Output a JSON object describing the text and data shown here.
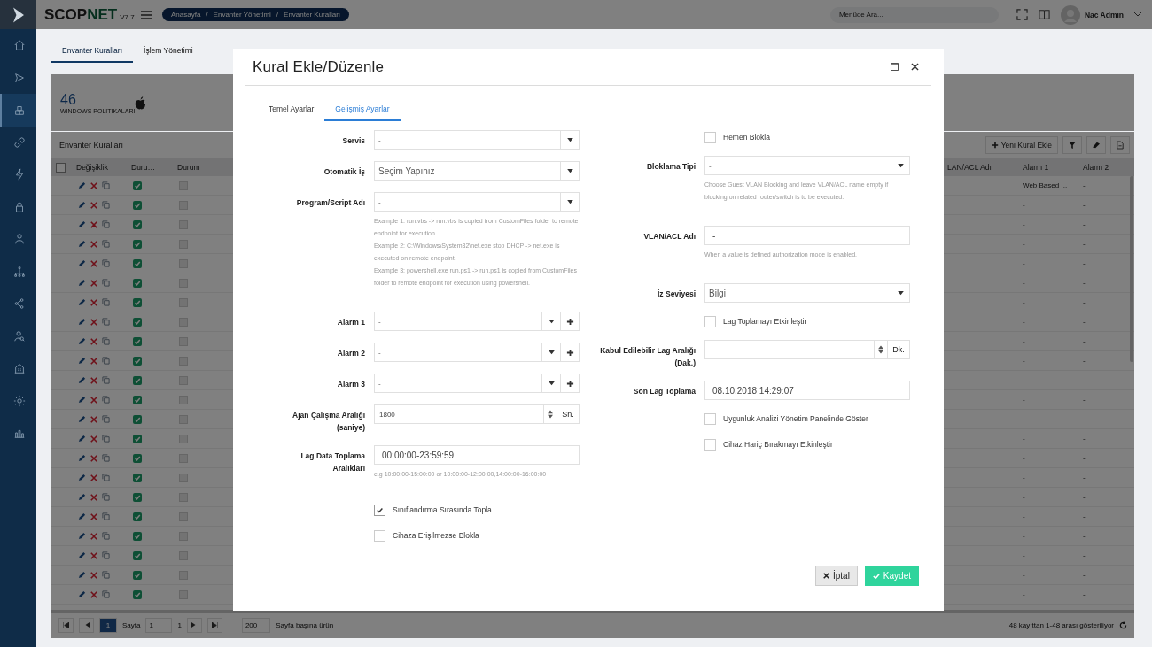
{
  "sidebar": {
    "items": [
      {
        "selected": false
      },
      {
        "selected": false
      },
      {
        "selected": true
      },
      {
        "selected": false
      },
      {
        "selected": false
      },
      {
        "selected": false
      },
      {
        "selected": false
      },
      {
        "selected": false
      },
      {
        "selected": false
      },
      {
        "selected": false
      },
      {
        "selected": false
      },
      {
        "selected": false
      },
      {
        "selected": false
      }
    ]
  },
  "topbar": {
    "logo_main": "SCOP",
    "logo_accent": "NET",
    "version": "V7.7",
    "breadcrumb": [
      "Anasayfa",
      "Envanter Yönetimi",
      "Envanter Kuralları"
    ],
    "breadcrumb_separator": "/",
    "search": {
      "placeholder": "Menüde Ara..."
    },
    "user": "Nac Admin"
  },
  "tabs": [
    {
      "label": "Envanter Kuralları",
      "selected": true
    },
    {
      "label": "İşlem Yönetimi",
      "selected": false
    }
  ],
  "stats": {
    "count": "46",
    "label": "WINDOWS POLITIKALARI"
  },
  "table": {
    "title": "Envanter Kuralları",
    "select_all_checked": false,
    "add_button": "Yeni Kural Ekle",
    "columns": [
      "Değişiklik",
      "Duru…",
      "Durum",
      "LAN/ACL Adı",
      "Alarm 1",
      "Alarm 2"
    ],
    "rows": [
      {
        "active": true,
        "durum": false,
        "alarm_1": "Web Based ...",
        "alarm_2": "-"
      },
      {
        "active": true,
        "durum": false,
        "alarm_1": "-",
        "alarm_2": "-"
      },
      {
        "active": true,
        "durum": false,
        "alarm_1": "-",
        "alarm_2": "-"
      },
      {
        "active": true,
        "durum": false,
        "alarm_1": "-",
        "alarm_2": "-"
      },
      {
        "active": true,
        "durum": false,
        "alarm_1": "-",
        "alarm_2": "-"
      },
      {
        "active": true,
        "durum": false,
        "alarm_1": "-",
        "alarm_2": "-"
      },
      {
        "active": true,
        "durum": false,
        "alarm_1": "-",
        "alarm_2": "-"
      },
      {
        "active": true,
        "durum": false,
        "alarm_1": "-",
        "alarm_2": "-"
      },
      {
        "active": true,
        "durum": false,
        "alarm_1": "-",
        "alarm_2": "-"
      },
      {
        "active": true,
        "durum": false,
        "alarm_1": "-",
        "alarm_2": "-"
      },
      {
        "active": true,
        "durum": false,
        "alarm_1": "-",
        "alarm_2": "-"
      },
      {
        "active": true,
        "durum": false,
        "alarm_1": "-",
        "alarm_2": "-"
      },
      {
        "active": true,
        "durum": false,
        "alarm_1": "-",
        "alarm_2": "-"
      },
      {
        "active": true,
        "durum": false,
        "alarm_1": "-",
        "alarm_2": "-"
      },
      {
        "active": true,
        "durum": false,
        "alarm_1": "-",
        "alarm_2": "-"
      },
      {
        "active": true,
        "durum": false,
        "alarm_1": "-",
        "alarm_2": "-"
      },
      {
        "active": true,
        "durum": false,
        "alarm_1": "-",
        "alarm_2": "-"
      },
      {
        "active": true,
        "durum": false,
        "alarm_1": "-",
        "alarm_2": "-"
      },
      {
        "active": true,
        "durum": false,
        "alarm_1": "-",
        "alarm_2": "-"
      },
      {
        "active": true,
        "durum": false,
        "alarm_1": "-",
        "alarm_2": "-"
      },
      {
        "active": true,
        "durum": false,
        "alarm_1": "-",
        "alarm_2": "-"
      },
      {
        "active": true,
        "durum": false,
        "alarm_1": "-",
        "alarm_2": "-"
      }
    ]
  },
  "pagination": {
    "page": "1",
    "page_label": "Sayfa",
    "page_input": "1",
    "page_total": "1",
    "page_size": "200",
    "page_size_label": "Sayfa başına ürün",
    "summary": "48 kayıttan 1-48 arası gösteriliyor"
  },
  "modal": {
    "title": "Kural Ekle/Düzenle",
    "tabs": [
      {
        "label": "Temel Ayarlar",
        "selected": false
      },
      {
        "label": "Gelişmiş Ayarlar",
        "selected": true
      }
    ],
    "left_fields": [
      {
        "kind": "select",
        "label": "Servis",
        "value": "-"
      },
      {
        "kind": "select",
        "label": "Otomatik İş",
        "value": "Seçim Yapınız"
      },
      {
        "kind": "select",
        "label": "Program/Script Adı",
        "value": "-",
        "hints": [
          "Example 1: run.vbs -> run.vbs is copied from CustomFiles folder to remote endpoint for execution.",
          "Example 2: C:\\Windows\\System32\\net.exe stop DHCP -> net.exe is executed on remote endpoint.",
          "Example 3: powershell.exe run.ps1 -> run.ps1 is copied from CustomFiles folder to remote endpoint for execution using powershell."
        ]
      },
      {
        "kind": "select",
        "label": "Alarm 1",
        "value": "-",
        "addable": true
      },
      {
        "kind": "select",
        "label": "Alarm 2",
        "value": "-",
        "addable": true
      },
      {
        "kind": "select",
        "label": "Alarm 3",
        "value": "-",
        "addable": true
      },
      {
        "kind": "number",
        "label": "Ajan Çalışma Aralığı (saniye)",
        "value": "1800",
        "unit": "Sn."
      },
      {
        "kind": "text",
        "label": "Lag Data Toplama Aralıkları",
        "value": "00:00:00-23:59:59",
        "hints": [
          "e.g 10:00:00-15:00:00 or 10:00:00-12:00:00,14:00:00-16:00:00"
        ]
      },
      {
        "kind": "checkbox",
        "label": "Sınıflandırma Sırasında Topla",
        "checked": true
      },
      {
        "kind": "checkbox",
        "label": "Cihaza Erişilmezse Blokla",
        "checked": false
      }
    ],
    "right_fields": [
      {
        "kind": "checkbox",
        "label": "Hemen Blokla",
        "checked": false
      },
      {
        "kind": "select",
        "label": "Bloklama Tipi",
        "value": "-",
        "hints": [
          "Choose Guest VLAN Blocking and leave VLAN/ACL name empty if blocking on related router/switch is to be executed."
        ]
      },
      {
        "kind": "text",
        "label": "VLAN/ACL Adı",
        "value": "-",
        "hints": [
          "When a value is defined authorization mode is enabled."
        ]
      },
      {
        "kind": "select",
        "label": "İz Seviyesi",
        "value": "Bilgi"
      },
      {
        "kind": "checkbox",
        "label": "Lag Toplamayı Etkinleştir",
        "checked": false
      },
      {
        "kind": "number",
        "label": "Kabul Edilebilir Lag Aralığı (Dak.)",
        "unit": "Dk."
      },
      {
        "kind": "text",
        "label": "Son Lag Toplama",
        "value": "08.10.2018 14:29:07"
      },
      {
        "kind": "checkbox",
        "label": "Uygunluk Analizi Yönetim Panelinde Göster",
        "checked": false
      },
      {
        "kind": "checkbox",
        "label": "Cihaz Hariç Bırakmayı Etkinleştir",
        "checked": false
      }
    ],
    "buttons": [
      {
        "kind": "cancel",
        "label": "İptal"
      },
      {
        "kind": "save",
        "label": "Kaydet"
      }
    ]
  }
}
